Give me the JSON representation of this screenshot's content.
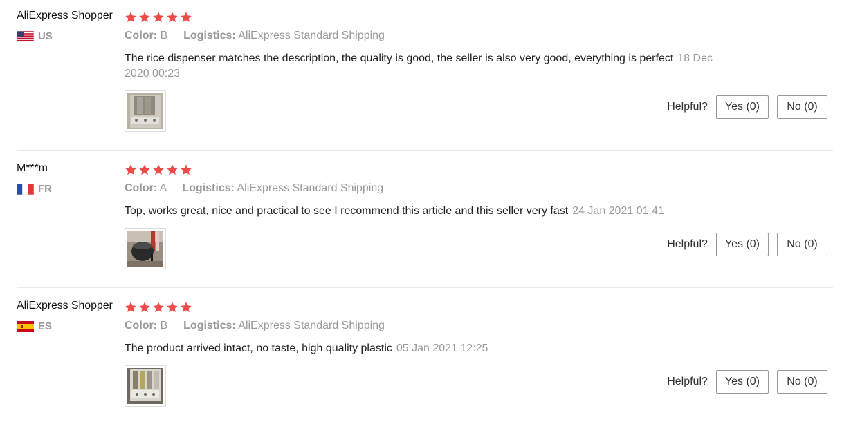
{
  "reviews": [
    {
      "name": "AliExpress Shopper",
      "rating": 5,
      "country": "US",
      "color_label": "Color:",
      "color_value": "B",
      "logistics_label": "Logistics:",
      "logistics_value": "AliExpress Standard Shipping",
      "text": "The rice dispenser matches the description, the quality is good, the seller is also very good, everything is perfect",
      "date": "18 Dec 2020 00:23",
      "helpful_label": "Helpful?",
      "yes_label": "Yes (0)",
      "no_label": "No (0)"
    },
    {
      "name": "M***m",
      "rating": 5,
      "country": "FR",
      "color_label": "Color:",
      "color_value": "A",
      "logistics_label": "Logistics:",
      "logistics_value": "AliExpress Standard Shipping",
      "text": "Top, works great, nice and practical to see I recommend this article and this seller very fast",
      "date": "24 Jan 2021 01:41",
      "helpful_label": "Helpful?",
      "yes_label": "Yes (0)",
      "no_label": "No (0)"
    },
    {
      "name": "AliExpress Shopper",
      "rating": 5,
      "country": "ES",
      "color_label": "Color:",
      "color_value": "B",
      "logistics_label": "Logistics:",
      "logistics_value": "AliExpress Standard Shipping",
      "text": "The product arrived intact, no taste, high quality plastic",
      "date": "05 Jan 2021 12:25",
      "helpful_label": "Helpful?",
      "yes_label": "Yes (0)",
      "no_label": "No (0)"
    }
  ],
  "colors": {
    "star": "#f04b4b",
    "muted": "#999999",
    "divider": "#e8e8e8"
  }
}
